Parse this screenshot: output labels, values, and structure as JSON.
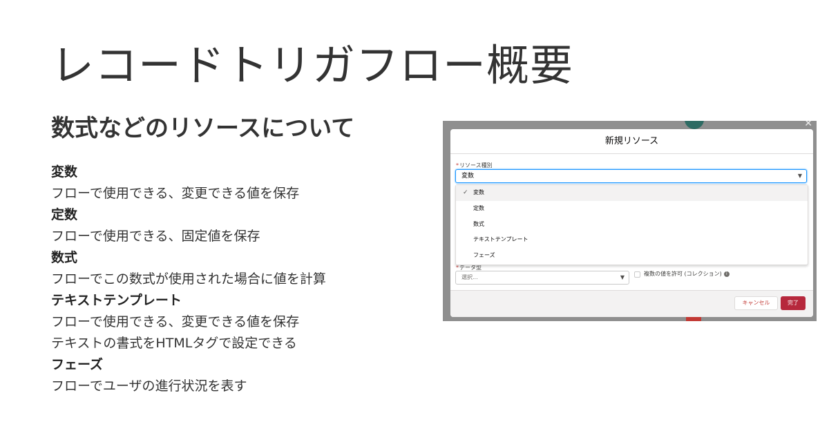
{
  "slide": {
    "title": "レコードトリガフロー概要",
    "subtitle": "数式などのリソースについて"
  },
  "items": [
    {
      "head": "変数",
      "desc": [
        "フローで使用できる、変更できる値を保存"
      ]
    },
    {
      "head": "定数",
      "desc": [
        "フローで使用できる、固定値を保存"
      ]
    },
    {
      "head": "数式",
      "desc": [
        "フローでこの数式が使用された場合に値を計算"
      ]
    },
    {
      "head": "テキストテンプレート",
      "desc": [
        "フローで使用できる、変更できる値を保存",
        "テキストの書式をHTMLタグで設定できる"
      ]
    },
    {
      "head": "フェーズ",
      "desc": [
        "フローでユーザの進行状況を表す"
      ]
    }
  ],
  "modal": {
    "title": "新規リソース",
    "resource_type_label": "リソース種別",
    "resource_type_value": "変数",
    "options": [
      "変数",
      "定数",
      "数式",
      "テキストテンプレート",
      "フェーズ"
    ],
    "selected_option": "変数",
    "data_type_label": "データ型",
    "data_type_placeholder": "選択...",
    "collection_label": "複数の値を許可 (コレクション)",
    "cancel_label": "キャンセル",
    "done_label": "完了"
  },
  "colors": {
    "accent_blue": "#1b96ff",
    "done_button": "#b6283c",
    "required": "#c23934"
  }
}
